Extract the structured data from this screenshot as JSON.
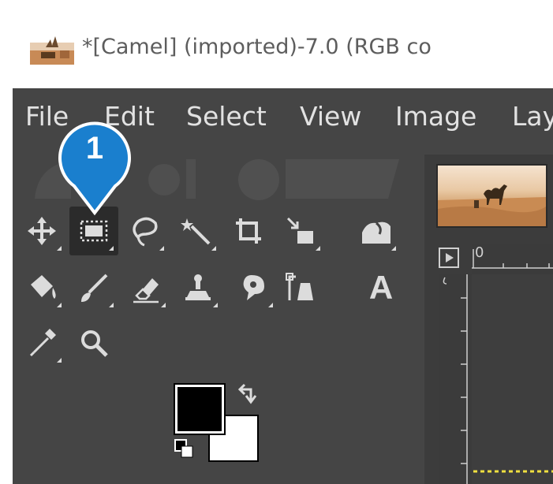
{
  "window": {
    "title": "*[Camel] (imported)-7.0 (RGB co"
  },
  "menubar": {
    "items": [
      "File",
      "Edit",
      "Select",
      "View",
      "Image",
      "Lay"
    ]
  },
  "callout": {
    "number": "1",
    "color": "#1a7fce"
  },
  "toolbox": {
    "tools": [
      {
        "name": "move-tool",
        "icon": "move-icon",
        "selected": false
      },
      {
        "name": "rectangle-select-tool",
        "icon": "rectangle-select-icon",
        "selected": true
      },
      {
        "name": "free-select-tool",
        "icon": "lasso-icon",
        "selected": false
      },
      {
        "name": "fuzzy-select-tool",
        "icon": "magic-wand-icon",
        "selected": false
      },
      {
        "name": "crop-tool",
        "icon": "crop-icon",
        "selected": false
      },
      {
        "name": "scale-tool",
        "icon": "scale-icon",
        "selected": false
      },
      {
        "name": "warp-tool",
        "icon": "warp-icon",
        "selected": false
      },
      {
        "name": "bucket-fill-tool",
        "icon": "bucket-fill-icon",
        "selected": false
      },
      {
        "name": "paintbrush-tool",
        "icon": "paintbrush-icon",
        "selected": false
      },
      {
        "name": "eraser-tool",
        "icon": "eraser-icon",
        "selected": false
      },
      {
        "name": "clone-tool",
        "icon": "clone-stamp-icon",
        "selected": false
      },
      {
        "name": "smudge-tool",
        "icon": "smudge-icon",
        "selected": false
      },
      {
        "name": "paths-tool",
        "icon": "paths-icon",
        "selected": false
      },
      {
        "name": "text-tool",
        "icon": "text-icon",
        "label": "A",
        "selected": false
      },
      {
        "name": "color-picker-tool",
        "icon": "color-picker-icon",
        "selected": false
      },
      {
        "name": "zoom-tool",
        "icon": "zoom-icon",
        "selected": false
      }
    ]
  },
  "colors": {
    "foreground": "#000000",
    "background": "#ffffff"
  },
  "image_panel": {
    "ruler_origin": "0"
  },
  "theme": {
    "dark_bg": "#454545",
    "menu_text": "#e2e2e2"
  }
}
